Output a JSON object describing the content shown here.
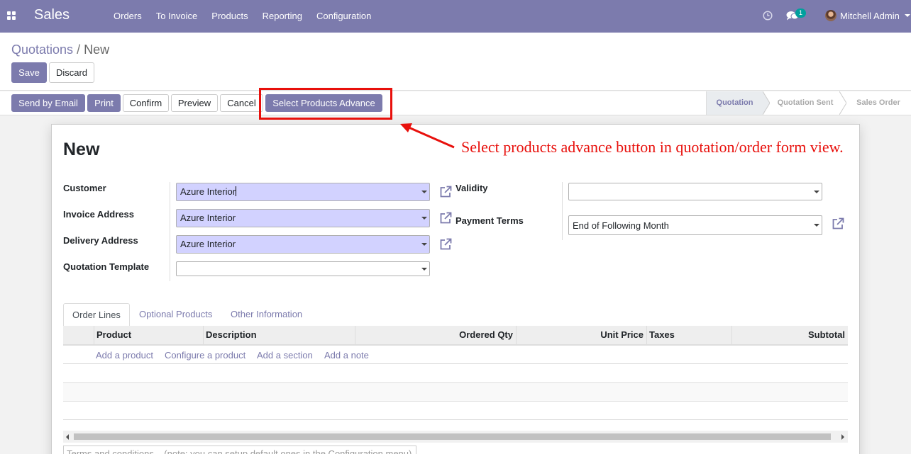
{
  "navbar": {
    "app_name": "Sales",
    "menu": [
      "Orders",
      "To Invoice",
      "Products",
      "Reporting",
      "Configuration"
    ],
    "messages_count": "1",
    "user_name": "Mitchell Admin",
    "icons": [
      "apps-icon",
      "clock-icon",
      "chat-icon"
    ],
    "color": "#7c7bad"
  },
  "breadcrumb": {
    "parent": "Quotations",
    "separator": "/",
    "current": "New"
  },
  "form_buttons": {
    "save": "Save",
    "discard": "Discard"
  },
  "header_buttons": {
    "send_by_email": "Send by Email",
    "print": "Print",
    "confirm": "Confirm",
    "preview": "Preview",
    "cancel": "Cancel",
    "select_products_advance": "Select Products Advance"
  },
  "statusbar": {
    "steps": [
      "Quotation",
      "Quotation Sent",
      "Sales Order"
    ],
    "active": "Quotation"
  },
  "annotation": {
    "text": "Select products advance button in quotation/order form view.",
    "color": "#e8100c"
  },
  "record": {
    "title": "New",
    "fields": {
      "customer": {
        "label": "Customer",
        "value": "Azure Interior"
      },
      "invoice_address": {
        "label": "Invoice Address",
        "value": "Azure Interior"
      },
      "delivery_address": {
        "label": "Delivery Address",
        "value": "Azure Interior"
      },
      "quotation_template": {
        "label": "Quotation Template",
        "value": ""
      },
      "validity": {
        "label": "Validity",
        "value": ""
      },
      "payment_terms": {
        "label": "Payment Terms",
        "value": "End of Following Month"
      }
    }
  },
  "notebook": {
    "tabs": [
      "Order Lines",
      "Optional Products",
      "Other Information"
    ],
    "active_tab": "Order Lines",
    "columns": [
      "Product",
      "Description",
      "Ordered Qty",
      "Unit Price",
      "Taxes",
      "Subtotal"
    ],
    "add_links": [
      "Add a product",
      "Configure a product",
      "Add a section",
      "Add a note"
    ]
  },
  "terms_placeholder": "Terms and conditions... (note: you can setup default ones in the Configuration menu)"
}
